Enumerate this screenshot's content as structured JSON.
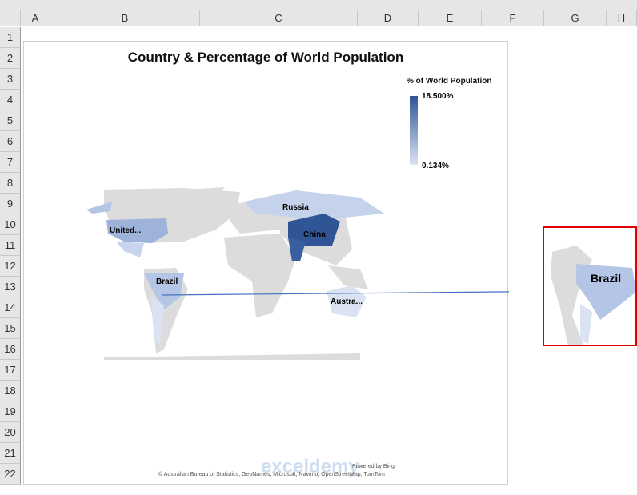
{
  "columns": [
    "A",
    "B",
    "C",
    "D",
    "E",
    "F",
    "G",
    "H"
  ],
  "rows": [
    "1",
    "2",
    "3",
    "4",
    "5",
    "6",
    "7",
    "8",
    "9",
    "10",
    "11",
    "12",
    "13",
    "14",
    "15",
    "16",
    "17",
    "18",
    "19",
    "20",
    "21",
    "22"
  ],
  "chart": {
    "title": "Country & Percentage of World Population",
    "legend": {
      "title": "% of World Population",
      "max": "18.500%",
      "min": "0.134%",
      "color_max": "#2f5597",
      "color_min": "#dbe3f3"
    },
    "labels": {
      "us": "United...",
      "russia": "Russia",
      "china": "China",
      "brazil": "Brazil",
      "australia": "Austra..."
    },
    "powered": "Powered by Bing",
    "attribution": "© Australian Bureau of Statistics, GeoNames, Microsoft, Navinfo, OpenStreetMap, TomTom",
    "watermark": "exceldemy"
  },
  "zoom_callout": {
    "label": "Brazil"
  }
}
